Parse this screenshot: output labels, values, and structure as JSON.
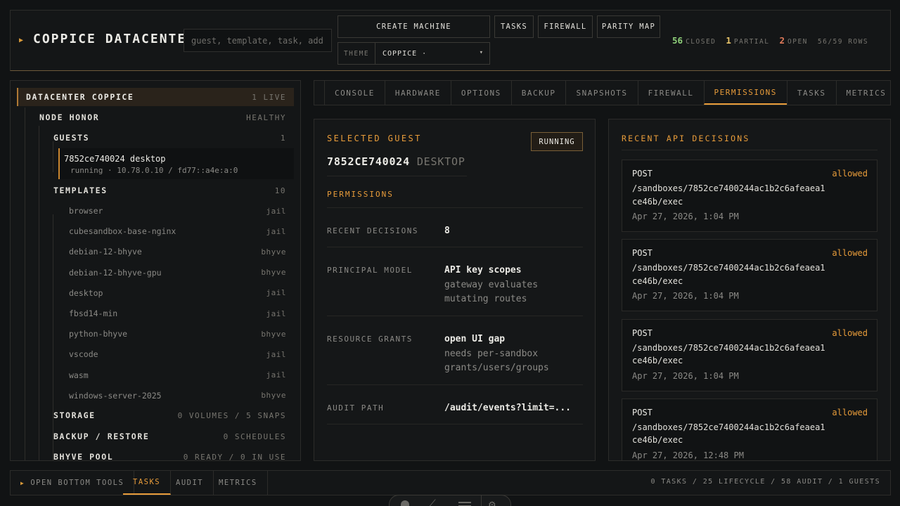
{
  "header": {
    "title": "COPPICE DATACENTER",
    "search_placeholder": "guest, template, task, address",
    "buttons": {
      "create": "CREATE MACHINE",
      "tasks": "TASKS",
      "firewall": "FIREWALL",
      "parity": "PARITY MAP"
    },
    "theme_label": "THEME",
    "theme_value": "COPPICE ·",
    "stats": {
      "closed_count": "56",
      "closed_label": "CLOSED",
      "partial_count": "1",
      "partial_label": "PARTIAL",
      "open_count": "2",
      "open_label": "OPEN",
      "rows": "56/59 ROWS"
    }
  },
  "sidebar": {
    "datacenter": {
      "label": "DATACENTER COPPICE",
      "meta": "1 LIVE"
    },
    "node": {
      "label": "NODE HONOR",
      "meta": "HEALTHY"
    },
    "guests": {
      "label": "GUESTS",
      "meta": "1"
    },
    "guest": {
      "name": "7852ce740024 desktop",
      "detail": "running · 10.78.0.10 / fd77::a4e:a:0"
    },
    "templates": {
      "label": "TEMPLATES",
      "meta": "10"
    },
    "template_items": [
      {
        "name": "browser",
        "kind": "jail"
      },
      {
        "name": "cubesandbox-base-nginx",
        "kind": "jail"
      },
      {
        "name": "debian-12-bhyve",
        "kind": "bhyve"
      },
      {
        "name": "debian-12-bhyve-gpu",
        "kind": "bhyve"
      },
      {
        "name": "desktop",
        "kind": "jail"
      },
      {
        "name": "fbsd14-min",
        "kind": "jail"
      },
      {
        "name": "python-bhyve",
        "kind": "bhyve"
      },
      {
        "name": "vscode",
        "kind": "jail"
      },
      {
        "name": "wasm",
        "kind": "jail"
      },
      {
        "name": "windows-server-2025",
        "kind": "bhyve"
      }
    ],
    "storage": {
      "label": "STORAGE",
      "meta": "0 VOLUMES / 5 SNAPS"
    },
    "backup": {
      "label": "BACKUP / RESTORE",
      "meta": "0 SCHEDULES"
    },
    "pool": {
      "label": "BHYVE POOL",
      "meta": "0 READY / 0 IN USE"
    }
  },
  "tabs": [
    "CONSOLE",
    "HARDWARE",
    "OPTIONS",
    "BACKUP",
    "SNAPSHOTS",
    "FIREWALL",
    "PERMISSIONS",
    "TASKS",
    "METRICS"
  ],
  "guest_panel": {
    "section_title": "SELECTED GUEST",
    "status_badge": "RUNNING",
    "guest_id": "7852CE740024",
    "guest_type": "DESKTOP",
    "permissions_title": "PERMISSIONS",
    "rows": [
      {
        "key": "RECENT DECISIONS",
        "value": "8",
        "sub1": "",
        "sub2": ""
      },
      {
        "key": "PRINCIPAL MODEL",
        "value": "API key scopes",
        "sub1": "gateway evaluates",
        "sub2": "mutating routes"
      },
      {
        "key": "RESOURCE GRANTS",
        "value": "open UI gap",
        "sub1": "needs per-sandbox",
        "sub2": "grants/users/groups"
      },
      {
        "key": "AUDIT PATH",
        "value": "/audit/events?limit=...",
        "sub1": "",
        "sub2": ""
      }
    ]
  },
  "api_panel": {
    "title": "RECENT API DECISIONS",
    "cards": [
      {
        "method": "POST",
        "path": "/sandboxes/7852ce7400244ac1b2c6afeaea1ce46b/exec",
        "status": "allowed",
        "time": "Apr 27, 2026, 1:04 PM"
      },
      {
        "method": "POST",
        "path": "/sandboxes/7852ce7400244ac1b2c6afeaea1ce46b/exec",
        "status": "allowed",
        "time": "Apr 27, 2026, 1:04 PM"
      },
      {
        "method": "POST",
        "path": "/sandboxes/7852ce7400244ac1b2c6afeaea1ce46b/exec",
        "status": "allowed",
        "time": "Apr 27, 2026, 1:04 PM"
      },
      {
        "method": "POST",
        "path": "/sandboxes/7852ce7400244ac1b2c6afeaea1ce46b/exec",
        "status": "allowed",
        "time": "Apr 27, 2026, 12:48 PM"
      }
    ]
  },
  "bottombar": {
    "open_tools": "OPEN BOTTOM TOOLS",
    "tabs": [
      "TASKS",
      "AUDIT",
      "METRICS"
    ],
    "summary": "0 TASKS / 25 LIFECYCLE / 58 AUDIT / 1 GUESTS"
  },
  "colors": {
    "accent": "#e89c3a",
    "closed": "#8fd07a",
    "partial": "#e8c46a",
    "open": "#e07a5a"
  },
  "icons": [
    "caret-right-icon",
    "chevron-down-icon",
    "dock-app-icon",
    "dock-rocket-icon",
    "dock-menu-icon",
    "dock-gear-icon"
  ]
}
